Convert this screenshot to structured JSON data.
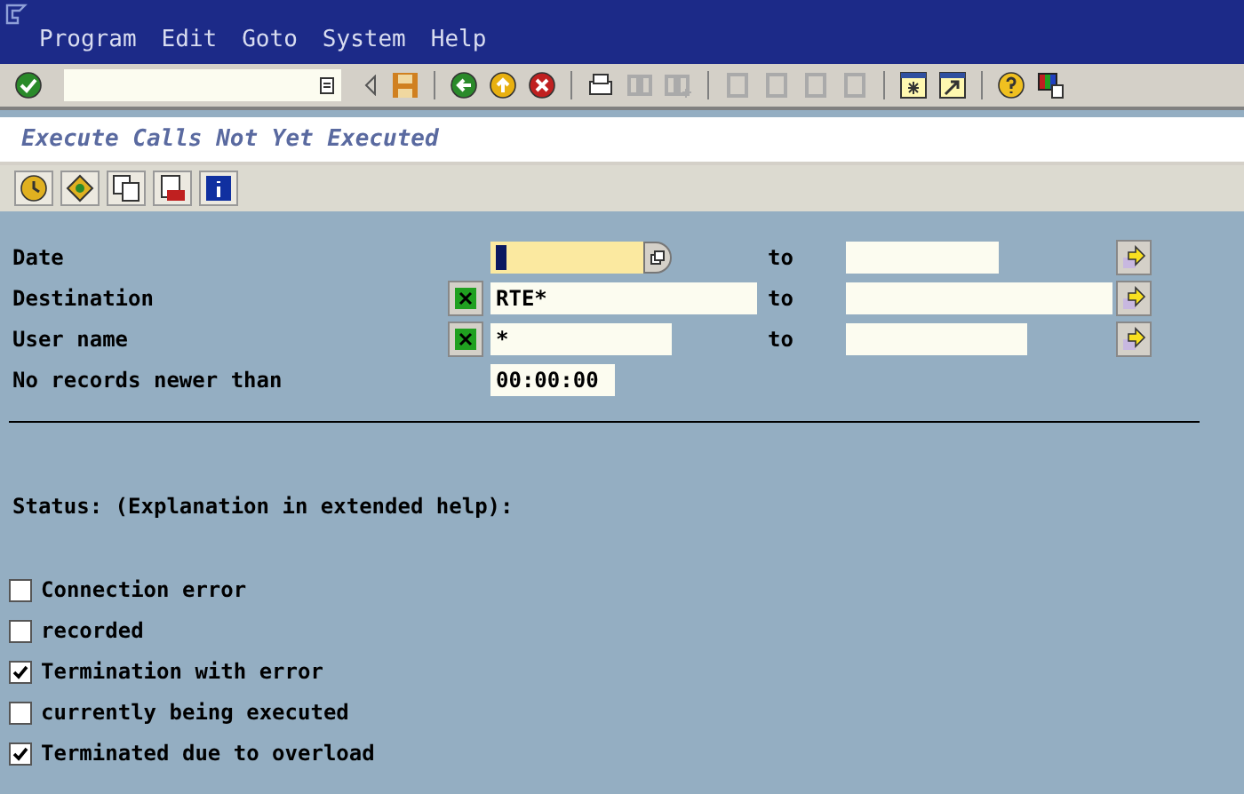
{
  "menu": [
    "Program",
    "Edit",
    "Goto",
    "System",
    "Help"
  ],
  "title": "Execute Calls Not Yet Executed",
  "fields": [
    {
      "kind": "date_range",
      "label": "Date",
      "focused": true,
      "to_label": "to"
    },
    {
      "kind": "range",
      "label": "Destination",
      "value": "RTE*",
      "focused": false,
      "to_label": "to"
    },
    {
      "kind": "range",
      "label": "User name",
      "value": "*",
      "focused": false,
      "to_label": "to"
    },
    {
      "kind": "time",
      "label": "No records newer than",
      "value": "00:00:00",
      "focused": false
    }
  ],
  "status_heading": "Status: (Explanation in extended help):",
  "status_options": [
    {
      "label": "Connection error",
      "checked": false
    },
    {
      "label": "recorded",
      "checked": false
    },
    {
      "label": "Termination with error",
      "checked": true
    },
    {
      "label": "currently being executed",
      "checked": false
    },
    {
      "label": "Terminated due to overload",
      "checked": true
    }
  ]
}
